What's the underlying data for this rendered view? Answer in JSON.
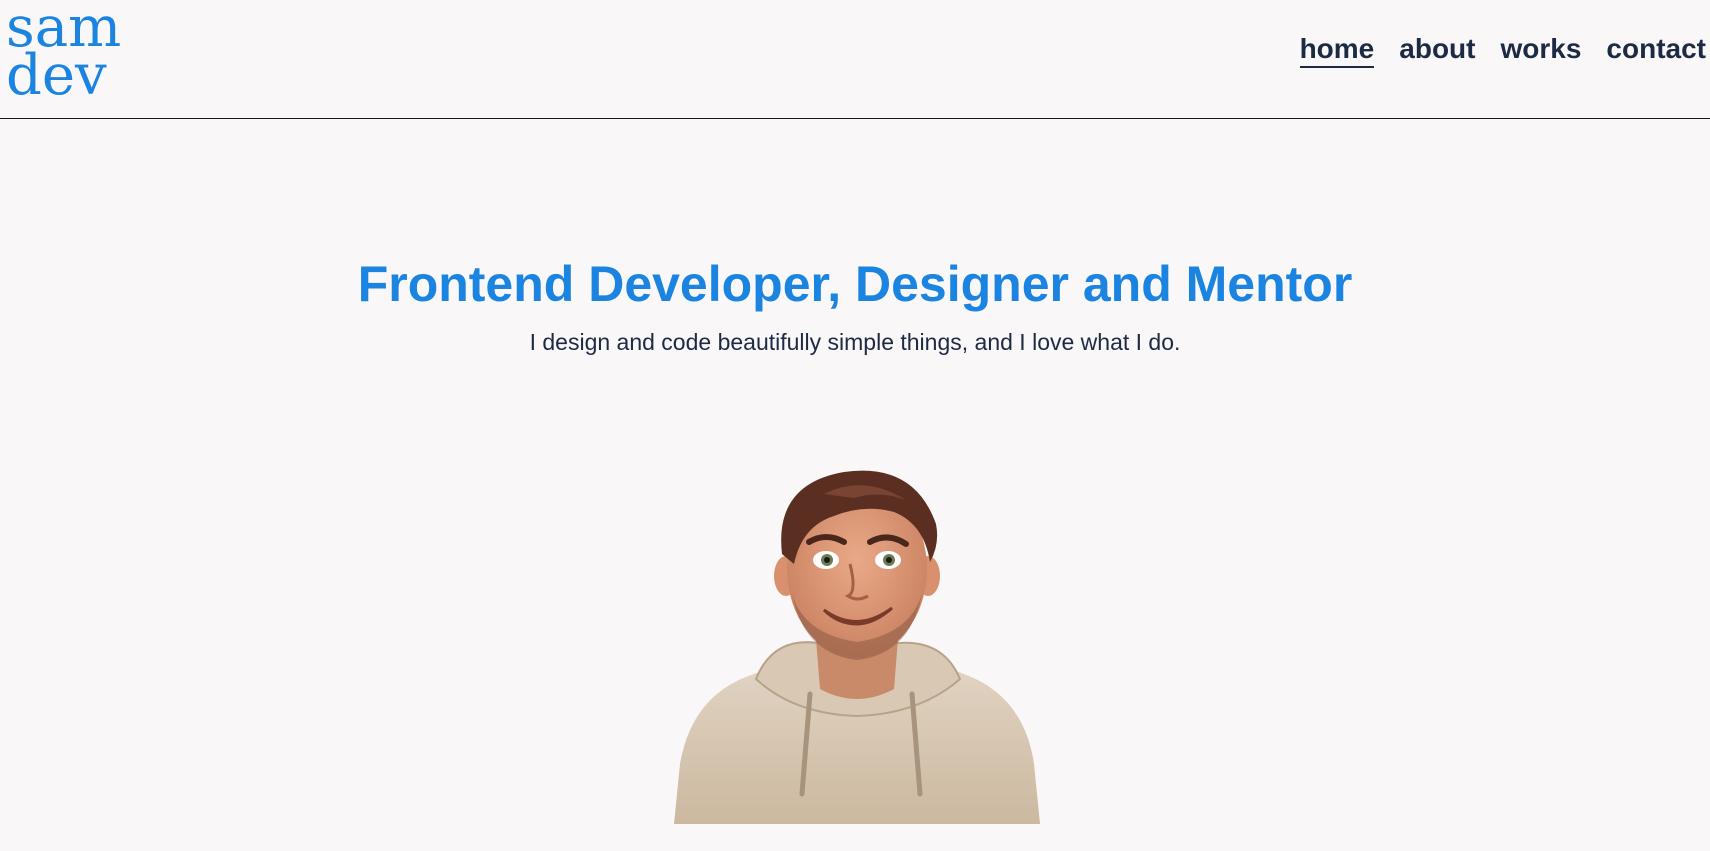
{
  "logo": {
    "line1": "sam",
    "line2": "dev",
    "color": "#1a84e0"
  },
  "nav": {
    "items": [
      {
        "label": "home",
        "active": true
      },
      {
        "label": "about",
        "active": false
      },
      {
        "label": "works",
        "active": false
      },
      {
        "label": "contact",
        "active": false
      }
    ]
  },
  "hero": {
    "title": "Frontend Developer, Designer and Mentor",
    "subtitle": "I design and code beautifully simple things, and I love what I do."
  },
  "colors": {
    "accent": "#1a84e0",
    "text": "#1d2a44",
    "background": "#f9f7f8"
  },
  "avatar": {
    "icon": "cartoon-developer-avatar"
  }
}
